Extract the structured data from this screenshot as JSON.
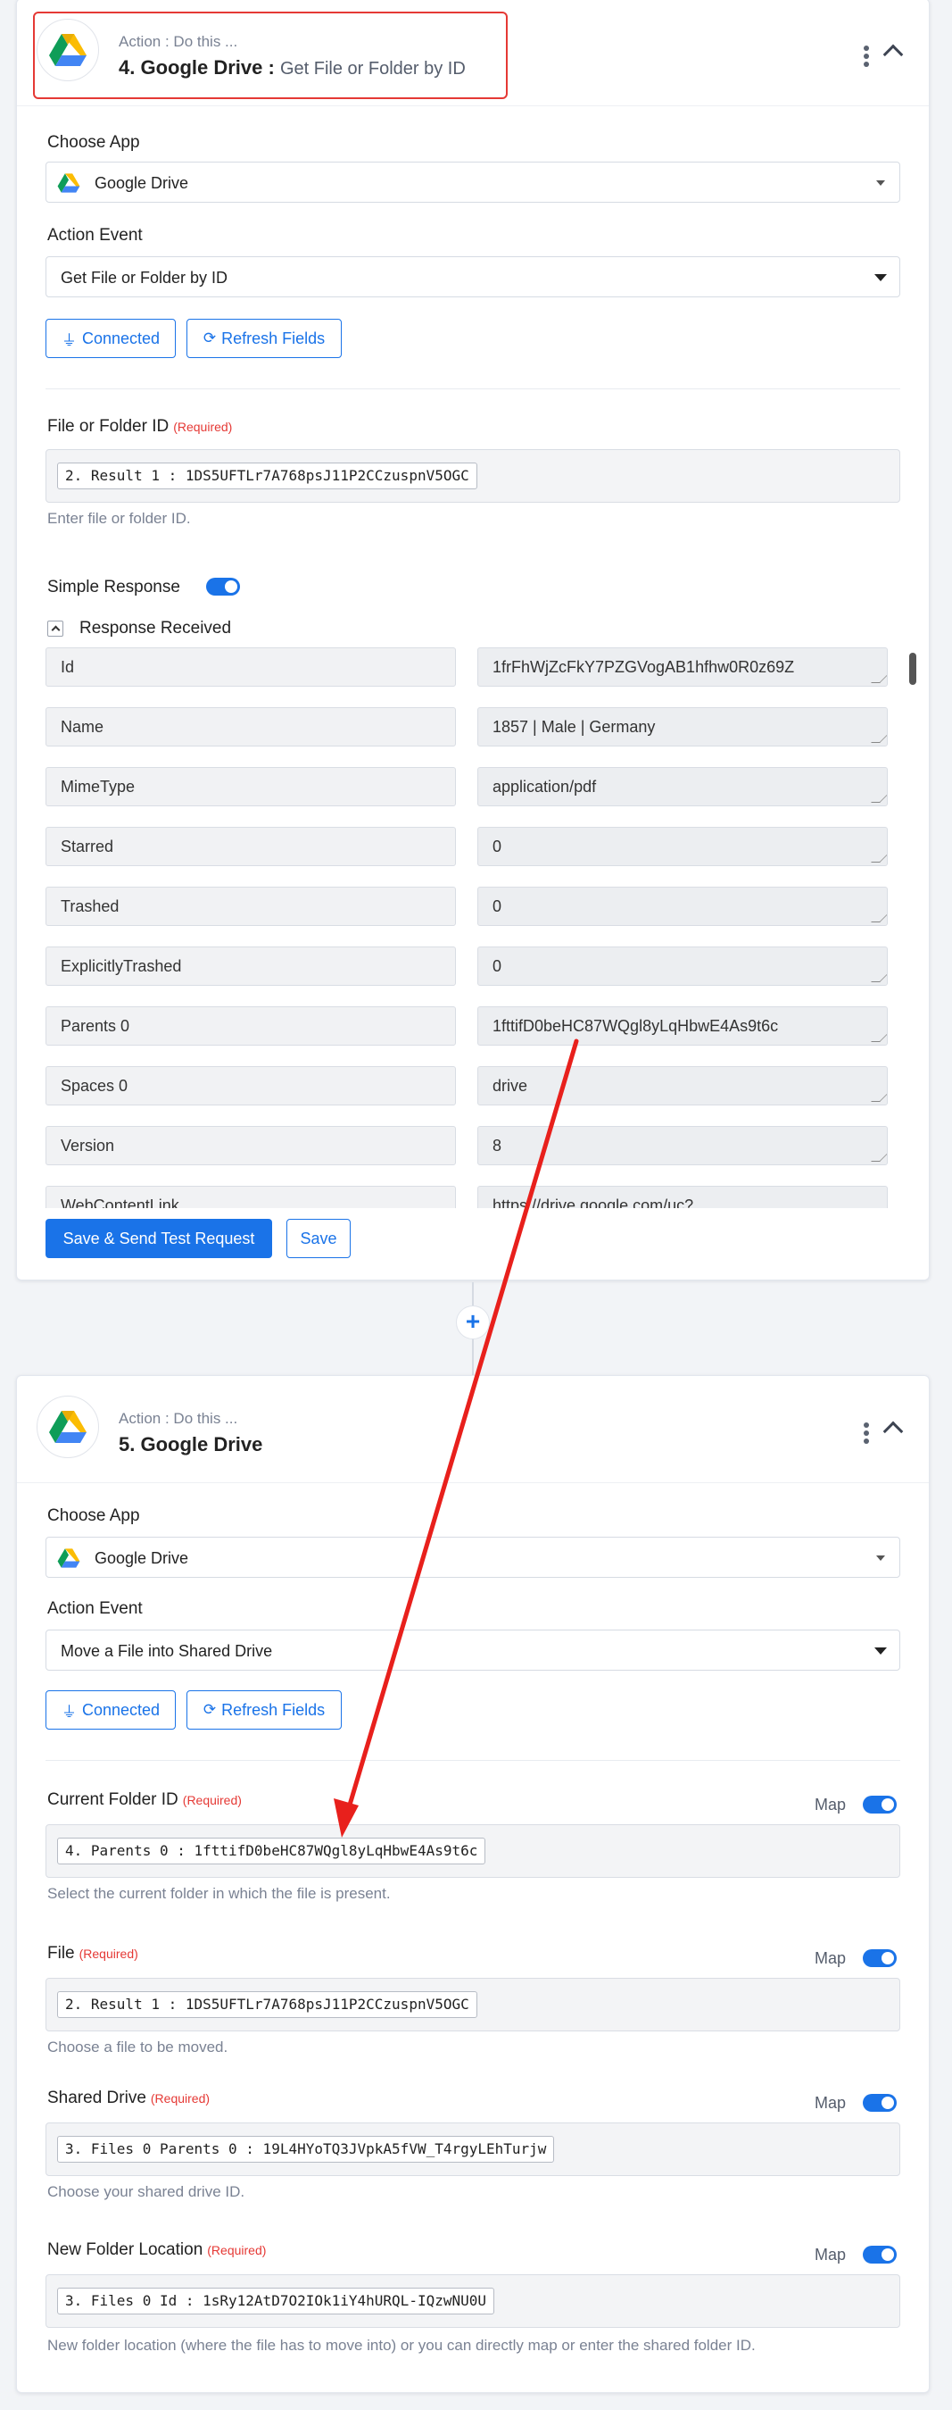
{
  "step4": {
    "action_prefix": "Action : Do this ...",
    "title": "4. Google Drive : ",
    "event_title": "Get File or Folder by ID",
    "choose_app_label": "Choose App",
    "app_value": "Google Drive",
    "action_event_label": "Action Event",
    "action_event_value": "Get File or Folder by ID",
    "connected_label": "Connected",
    "refresh_label": "Refresh Fields",
    "file_field": {
      "label": "File or Folder ID",
      "required": "(Required)",
      "value": "2. Result 1 : 1DS5UFTLr7A768psJ11P2CCzuspnV5OGC",
      "helper": "Enter file or folder ID."
    },
    "simple_response_label": "Simple Response",
    "response_received_label": "Response Received",
    "response_rows": [
      {
        "key": "Id",
        "value": "1frFhWjZcFkY7PZGVogAB1hfhw0R0z69Z"
      },
      {
        "key": "Name",
        "value": "1857 |  Male | Germany"
      },
      {
        "key": "MimeType",
        "value": "application/pdf"
      },
      {
        "key": "Starred",
        "value": "0"
      },
      {
        "key": "Trashed",
        "value": "0"
      },
      {
        "key": "ExplicitlyTrashed",
        "value": "0"
      },
      {
        "key": "Parents 0",
        "value": "1fttifD0beHC87WQgl8yLqHbwE4As9t6c"
      },
      {
        "key": "Spaces 0",
        "value": "drive"
      },
      {
        "key": "Version",
        "value": "8"
      },
      {
        "key": "WebContentLink",
        "value": "https://drive.google.com/uc?"
      }
    ],
    "save_test_label": "Save & Send Test Request",
    "save_label": "Save"
  },
  "step5": {
    "action_prefix": "Action : Do this ...",
    "title": "5. Google Drive",
    "choose_app_label": "Choose App",
    "app_value": "Google Drive",
    "action_event_label": "Action Event",
    "action_event_value": "Move a File into Shared Drive",
    "connected_label": "Connected",
    "refresh_label": "Refresh Fields",
    "map_label": "Map",
    "fields": [
      {
        "label": "Current Folder ID",
        "required": "(Required)",
        "value": "4. Parents 0 : 1fttifD0beHC87WQgl8yLqHbwE4As9t6c",
        "helper": "Select the current folder in which the file is present."
      },
      {
        "label": "File",
        "required": "(Required)",
        "value": "2. Result 1 : 1DS5UFTLr7A768psJ11P2CCzuspnV5OGC",
        "helper": "Choose a file to be moved."
      },
      {
        "label": "Shared Drive",
        "required": "(Required)",
        "value": "3. Files 0 Parents 0 : 19L4HYoTQ3JVpkA5fVW_T4rgyLEhTurjw",
        "helper": "Choose your shared drive ID."
      },
      {
        "label": "New Folder Location",
        "required": "(Required)",
        "value": "3. Files 0 Id : 1sRy12AtD7O2IOk1iY4hURQL-IQzwNU0U",
        "helper": "New folder location (where the file has to move into) or you can directly map or enter the shared folder ID."
      }
    ]
  },
  "colors": {
    "accent": "#1a73e8",
    "required": "#e53935",
    "annotation_arrow": "#e8201c"
  }
}
